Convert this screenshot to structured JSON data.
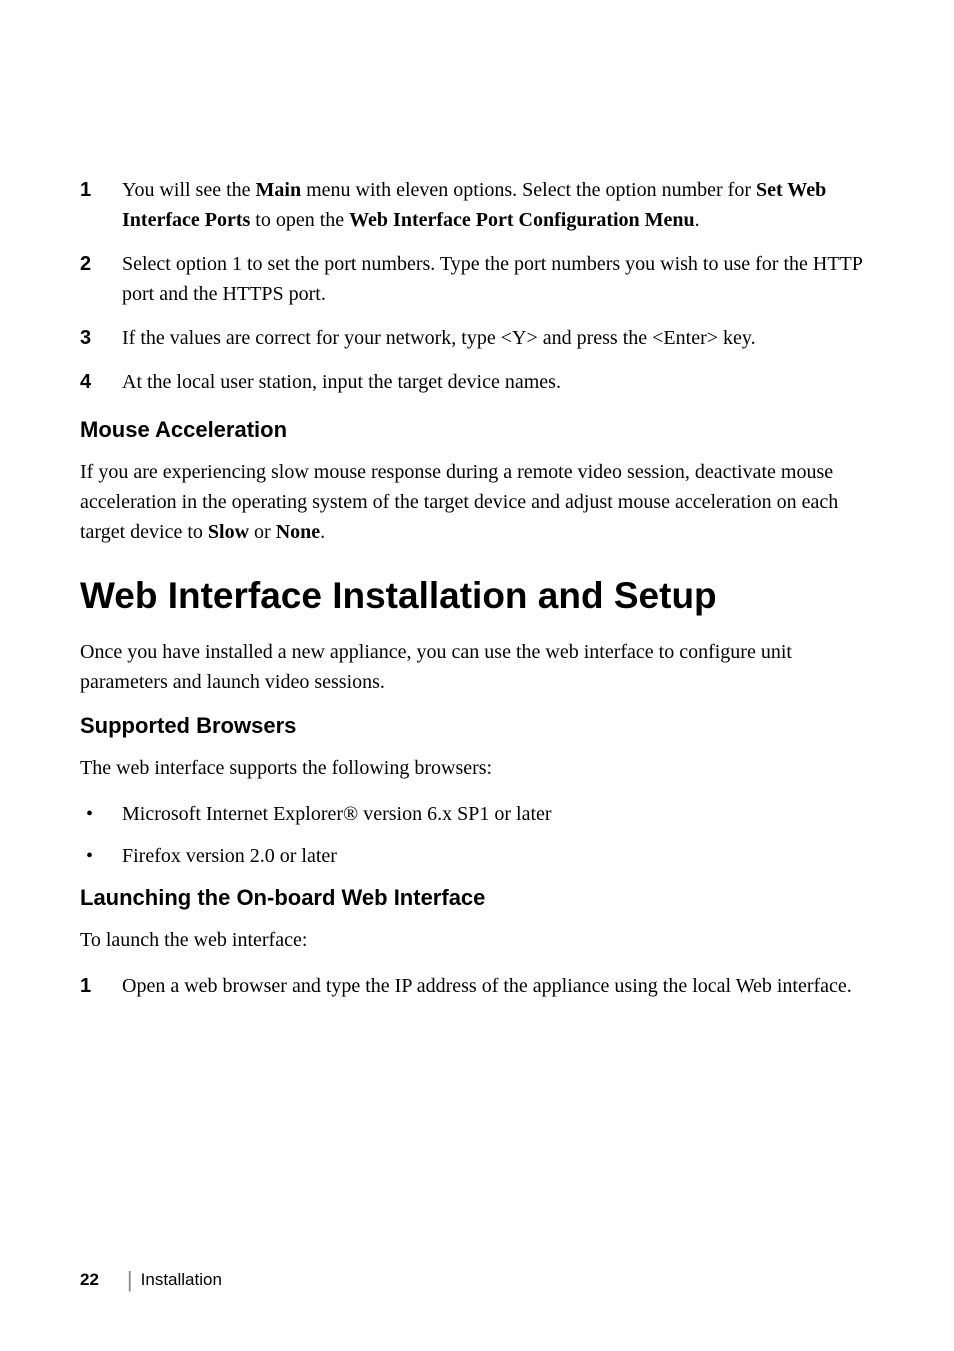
{
  "numlist1": {
    "items": [
      {
        "num": "1",
        "pre": "You will see the ",
        "b1": "Main",
        "mid1": " menu with eleven options. Select the option number for ",
        "b2": "Set Web Interface Ports",
        "mid2": " to open the ",
        "b3": "Web Interface Port Configuration Menu",
        "post": "."
      },
      {
        "num": "2",
        "text": "Select option 1 to set the port numbers. Type the port numbers you wish to use for the HTTP port and the HTTPS port."
      },
      {
        "num": "3",
        "text": "If the values are correct for your network, type <Y> and press the <Enter> key."
      },
      {
        "num": "4",
        "text": "At the local user station, input the target device names."
      }
    ]
  },
  "mouse_accel": {
    "heading": "Mouse Acceleration",
    "para_pre": "If you are experiencing slow mouse response during a remote video session, deactivate mouse acceleration in the operating system of the target device and adjust mouse acceleration on each target device to ",
    "b1": "Slow",
    "mid": " or ",
    "b2": "None",
    "post": "."
  },
  "web_setup": {
    "heading": "Web Interface Installation and Setup",
    "intro": "Once you have installed a new appliance, you can use the web interface to configure unit parameters and launch video sessions."
  },
  "browsers": {
    "heading": "Supported Browsers",
    "intro": "The web interface supports the following browsers:",
    "items": [
      "Microsoft Internet Explorer® version 6.x SP1 or later",
      "Firefox version 2.0 or later"
    ]
  },
  "launch": {
    "heading": "Launching the On-board Web Interface",
    "intro": "To launch the web interface:",
    "items": [
      {
        "num": "1",
        "text": "Open a web browser and type the IP address of the appliance using the local Web interface."
      }
    ]
  },
  "footer": {
    "page": "22",
    "section": "Installation"
  }
}
